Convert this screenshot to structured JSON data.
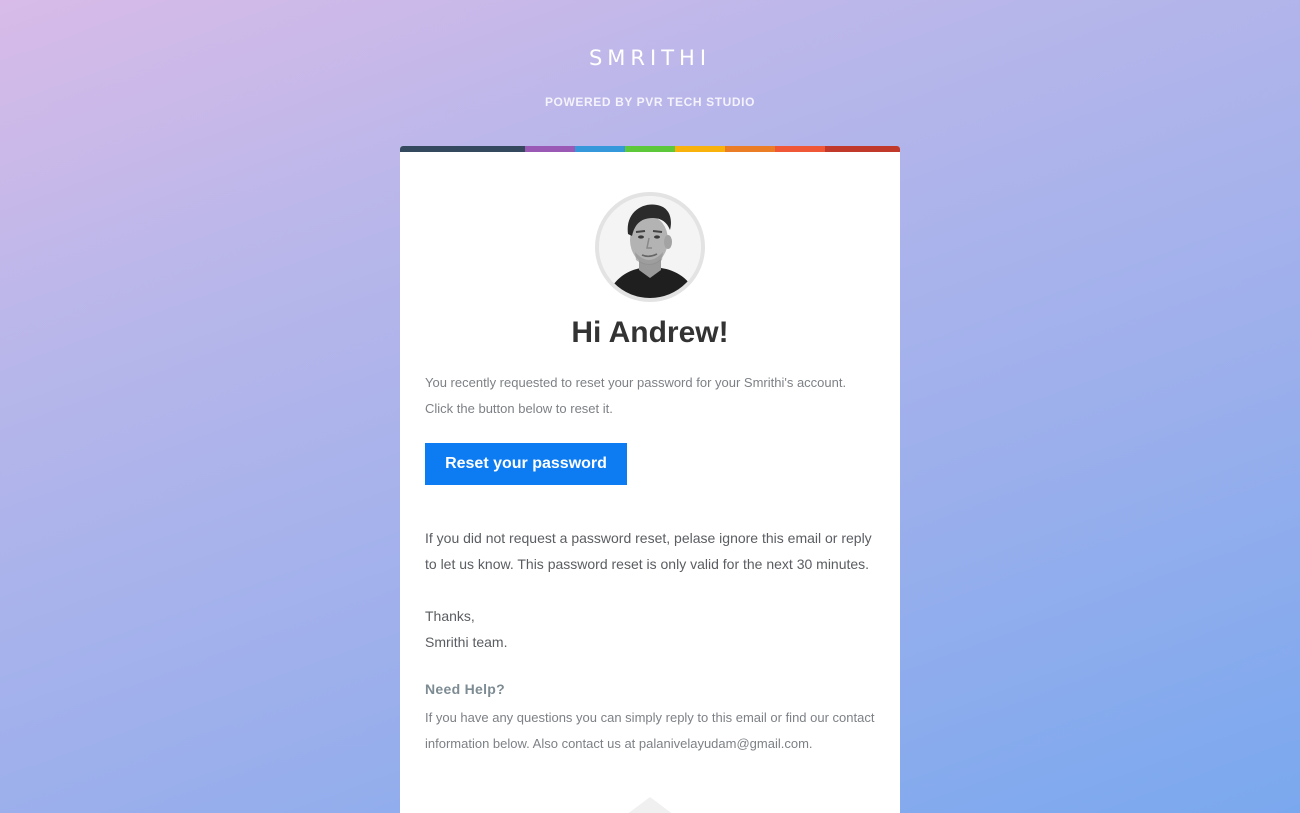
{
  "brand": {
    "name": "SMRITHI",
    "powered_by": "POWERED BY PVR TECH STUDIO"
  },
  "color_bar": {
    "colors": [
      "#34495e",
      "#9b59b6",
      "#3498db",
      "#5cc83a",
      "#f9b10c",
      "#ea7d25",
      "#ef5737",
      "#c0392b"
    ]
  },
  "email": {
    "greeting": "Hi Andrew!",
    "intro_line1": "You recently requested to reset your password for your Smrithi's account.",
    "intro_line2": "Click the button below to reset it.",
    "button_label": "Reset your password",
    "notice": "If you did not request a password reset, pelase ignore this email or reply to let us know. This password reset is only valid for the next 30 minutes.",
    "thanks": "Thanks,",
    "signature": "Smrithi team.",
    "help_title": "Need Help?",
    "help_text": "If you have any questions you can simply reply to this email or find our contact information below. Also contact us at palanivelayudam@gmail.com."
  },
  "colors": {
    "button": "#0d7cf2",
    "heading": "#333333",
    "muted_text": "#7d8186",
    "body_text": "#5a5d61"
  },
  "icons": {
    "avatar": "user-avatar-photo",
    "footer_deco": "chevron-up-icon"
  }
}
